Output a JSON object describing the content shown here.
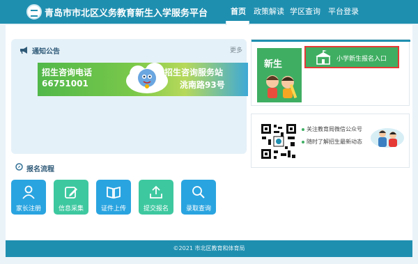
{
  "header": {
    "site_title": "青岛市市北区义务教育新生入学服务平台",
    "nav": [
      "首页",
      "政策解读",
      "学区查询",
      "平台登录"
    ],
    "active_nav": "首页"
  },
  "notice": {
    "title": "通知公告",
    "more": "更多"
  },
  "banner": {
    "left_label": "招生咨询电话",
    "left_value": "66751001",
    "right_label": "招生咨询服务站",
    "right_value": "洮南路93号"
  },
  "flow": {
    "title": "报名流程",
    "steps": [
      {
        "label": "家长注册",
        "icon": "user-icon",
        "color": "#2aa4e0"
      },
      {
        "label": "信息采集",
        "icon": "edit-icon",
        "color": "#3ec8a0"
      },
      {
        "label": "证件上传",
        "icon": "book-icon",
        "color": "#2aa4e0"
      },
      {
        "label": "提交报名",
        "icon": "upload-icon",
        "color": "#3ec8a0"
      },
      {
        "label": "录取查询",
        "icon": "search-icon",
        "color": "#2aa4e0"
      }
    ]
  },
  "enroll": {
    "newbie_label": "新生",
    "button_label": "小学新生报名入口"
  },
  "wechat": {
    "line1": "关注教育局微信公众号",
    "line2": "随时了解招生最新动态"
  },
  "footer": {
    "copyright": "©2021 市北区教育和体育局"
  },
  "colors": {
    "primary": "#1f8fb0",
    "green": "#3fae62",
    "highlight_border": "#e53935"
  }
}
